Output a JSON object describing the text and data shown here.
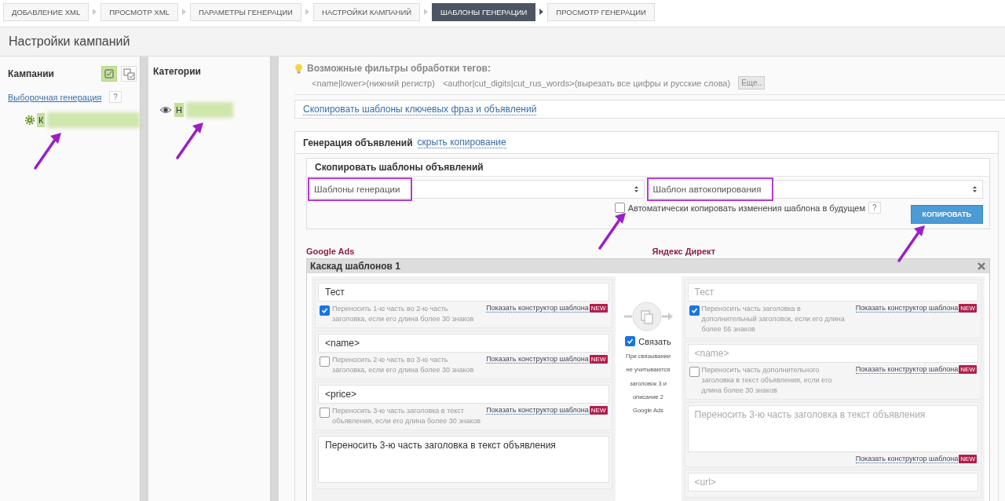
{
  "breadcrumbs": [
    {
      "label": "ДОБАВЛЕНИЕ XML",
      "selected": false
    },
    {
      "label": "ПРОСМОТР XML",
      "selected": false
    },
    {
      "label": "ПАРАМЕТРЫ ГЕНЕРАЦИИ",
      "selected": false
    },
    {
      "label": "НАСТРОЙКИ КАМПАНИЙ",
      "selected": false
    },
    {
      "label": "ШАБЛОНЫ ГЕНЕРАЦИИ",
      "selected": true
    },
    {
      "label": "ПРОСМОТР ГЕНЕРАЦИИ",
      "selected": false
    }
  ],
  "page_title": "Настройки кампаний",
  "campaigns": {
    "title": "Кампании",
    "view_buttons": [
      {
        "kind": "single",
        "selected": true
      },
      {
        "kind": "multi",
        "selected": false
      }
    ],
    "link": "Выборочная генерация",
    "help": "?",
    "items": [
      {
        "label": "К",
        "selected": true,
        "annotated": true
      }
    ]
  },
  "categories": {
    "title": "Категории",
    "items": [
      {
        "label": "Н",
        "selected": true,
        "annotated": true
      }
    ]
  },
  "filters": {
    "title": "Возможные фильтры обработки тегов:",
    "entries": [
      "<name|lower>(нижний регистр)",
      "<author|cut_digits|cut_rus_words>(вырезать все цифры и русские слова)"
    ],
    "more": "Еще.."
  },
  "copy_link": "Скопировать шаблоны ключевых фраз и объявлений",
  "ad_generation": {
    "title": "Генерация объявлений",
    "toggle": "скрыть копирование",
    "copy_box": {
      "title": "Скопировать шаблоны объявлений",
      "selects": [
        {
          "value": "Шаблоны генерации",
          "highlighted": true
        },
        {
          "value": "Шаблон автокопирования",
          "highlighted": true
        }
      ],
      "auto_copy": {
        "label": "Автоматически копировать изменения шаблона в будущем",
        "checked": false,
        "annotated": true
      },
      "help": "?",
      "button": {
        "label": "КОПИРОВАТЬ",
        "annotated": true
      }
    },
    "columns": [
      "Google Ads",
      "Яндекс Директ"
    ],
    "cascade": {
      "title": "Каскад шаблонов 1",
      "left": [
        {
          "kind": "input",
          "value": "Тест",
          "option": {
            "label": "Переносить 1-ю часть во 2-ю часть заголовка, если его длина более 30 знаков",
            "checked": true
          },
          "constructor": "Показать конструктор шаблона",
          "badge": "NEW"
        },
        {
          "kind": "input",
          "value": "<name>",
          "option": {
            "label": "Переносить 2-ю часть во 3-ю часть заголовка, если его длина более 30 знаков",
            "checked": false
          },
          "constructor": "Показать конструктор шаблона",
          "badge": "NEW"
        },
        {
          "kind": "input",
          "value": "<price>",
          "option": {
            "label": "Переносить 3-ю часть заголовка в текст объявления, если его длина более 30 знаков",
            "checked": false
          },
          "constructor": "Показать конструктор шаблона",
          "badge": "NEW"
        },
        {
          "kind": "textarea",
          "value": "Переносить 3-ю часть заголовка в текст объявления"
        }
      ],
      "link": {
        "label": "Связать",
        "checked": true,
        "note": "При связывании не учитываются заголовок 3 и описание 2 Google Ads"
      },
      "right": [
        {
          "kind": "input",
          "placeholder": "Тест",
          "option": {
            "label": "Переносить часть заголовка в дополнительный заголовок, если его длина более 56 знаков",
            "checked": true
          },
          "constructor": "Показать конструктор шаблона",
          "badge": "NEW"
        },
        {
          "kind": "input",
          "placeholder": "<name>",
          "option": {
            "label": "Переносить часть дополнительного заголовка в текст объявления, если его длина более 30 знаков",
            "checked": false
          },
          "constructor": "Показать конструктор шаблона",
          "badge": "NEW"
        },
        {
          "kind": "textarea",
          "placeholder": "Переносить 3-ю часть заголовка в текст объявления",
          "constructor": "Показать конструктор шаблона",
          "badge": "NEW"
        },
        {
          "kind": "input",
          "placeholder": "<url>"
        }
      ]
    }
  }
}
